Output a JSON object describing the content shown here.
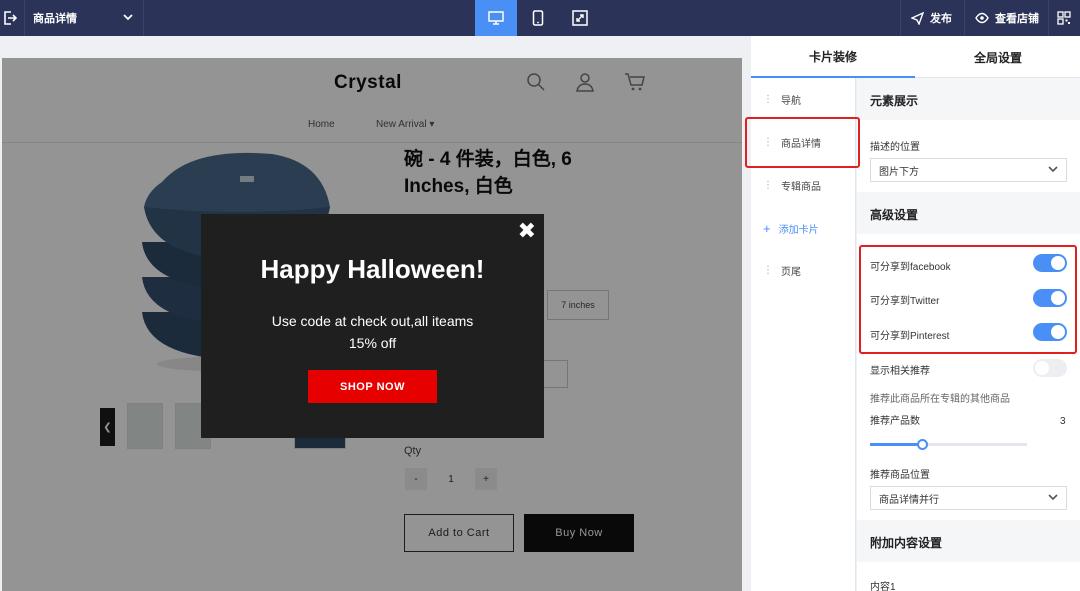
{
  "topbar": {
    "page_select": "商品详情",
    "publish": "发布",
    "view_store": "查看店铺"
  },
  "store": {
    "logo": "Crystal",
    "nav": [
      "Home",
      "New Arrival"
    ],
    "product_title": "碗 - 4 件装，白色, 6 Inches, 白色",
    "size_option": "7 inches",
    "qty_label": "Qty",
    "qty_minus": "-",
    "qty_value": "1",
    "qty_plus": "+",
    "add_to_cart": "Add to Cart",
    "buy_now": "Buy Now"
  },
  "popup": {
    "title": "Happy Halloween!",
    "line1": "Use code at check out,all iteams",
    "line2": "15% off",
    "button": "SHOP NOW",
    "button_color": "#e60000"
  },
  "panel": {
    "tabs": [
      "卡片装修",
      "全局设置"
    ],
    "cards": [
      "导航",
      "商品详情",
      "专辑商品",
      "添加卡片",
      "页尾"
    ],
    "element_display": {
      "title": "元素展示",
      "desc_position_label": "描述的位置",
      "desc_position_value": "图片下方"
    },
    "advanced": {
      "title": "高级设置",
      "share_facebook": "可分享到facebook",
      "share_twitter": "可分享到Twitter",
      "share_pinterest": "可分享到Pinterest",
      "show_related": "显示相关推荐",
      "related_hint": "推荐此商品所在专辑的其他商品",
      "recommend_count_label": "推荐产品数",
      "recommend_count_value": "3",
      "recommend_position_label": "推荐商品位置",
      "recommend_position_value": "商品详情并行"
    },
    "extra": {
      "title": "附加内容设置",
      "content1": "内容1"
    }
  },
  "colors": {
    "topbar": "#2b3358",
    "accent": "#4a8ff5",
    "highlight": "#e02020"
  }
}
